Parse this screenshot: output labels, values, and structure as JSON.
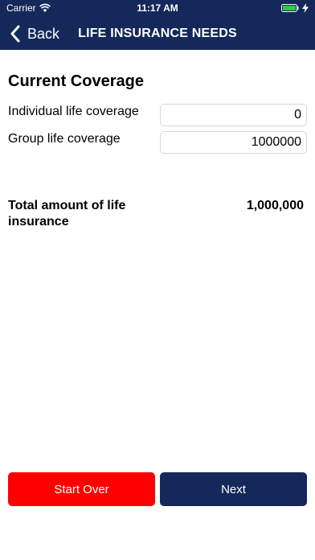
{
  "status_bar": {
    "carrier": "Carrier",
    "time": "11:17 AM"
  },
  "nav": {
    "back_label": "Back",
    "title": "LIFE INSURANCE NEEDS"
  },
  "section": {
    "title": "Current Coverage"
  },
  "fields": {
    "individual": {
      "label": "Individual life coverage",
      "value": "0"
    },
    "group": {
      "label": "Group life coverage",
      "value": "1000000"
    }
  },
  "total": {
    "label": "Total amount of life insurance",
    "value": "1,000,000"
  },
  "buttons": {
    "start_over": "Start Over",
    "next": "Next"
  },
  "colors": {
    "navbar": "#14285a",
    "start_over": "#fe0000",
    "next": "#14285a"
  }
}
